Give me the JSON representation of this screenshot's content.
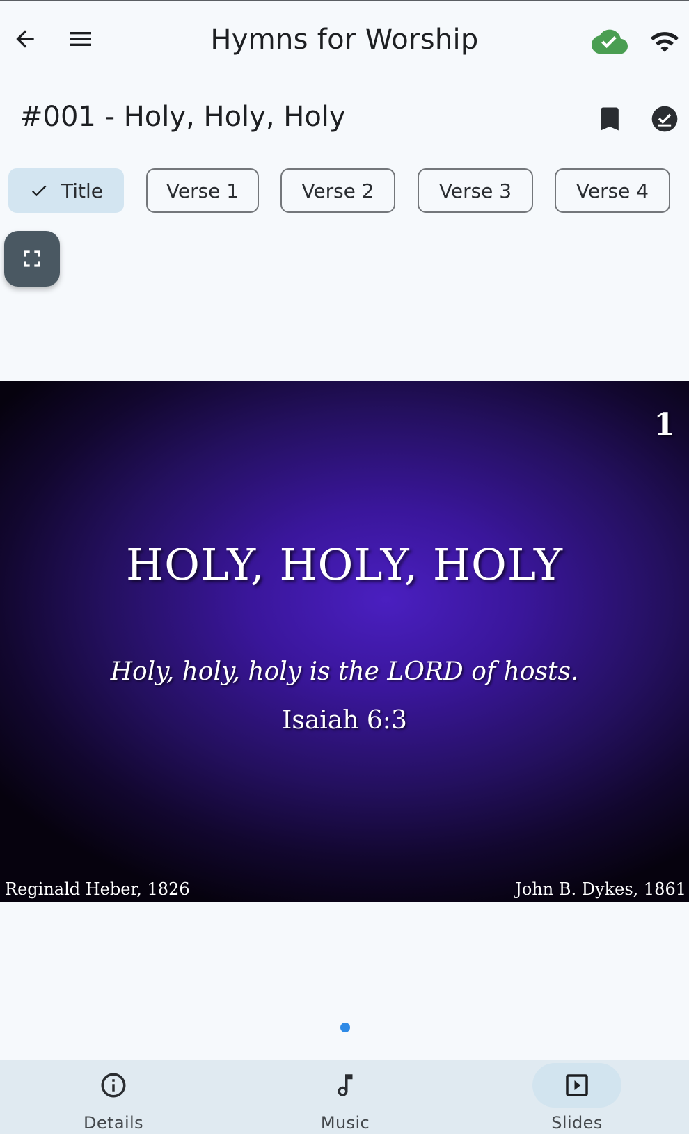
{
  "app_bar": {
    "title": "Hymns for Worship",
    "back_icon": "arrow-back-icon",
    "menu_icon": "menu-icon",
    "cloud_icon": "cloud-done-icon",
    "wifi_icon": "wifi-icon",
    "cloud_color": "#4a9e52"
  },
  "hymn": {
    "title": "#001 - Holy, Holy, Holy",
    "bookmark_icon": "bookmark-icon",
    "check_icon": "check-circle-icon"
  },
  "chips": [
    {
      "label": "Title",
      "selected": true
    },
    {
      "label": "Verse 1",
      "selected": false
    },
    {
      "label": "Verse 2",
      "selected": false
    },
    {
      "label": "Verse 3",
      "selected": false
    },
    {
      "label": "Verse 4",
      "selected": false
    }
  ],
  "fullscreen_icon": "fullscreen-icon",
  "slide": {
    "number": "1",
    "heading": "HOLY, HOLY, HOLY",
    "quote": "Holy, holy, holy is the LORD of hosts.",
    "reference": "Isaiah 6:3",
    "author": "Reginald Heber, 1826",
    "composer": "John B. Dykes, 1861"
  },
  "page_indicator": {
    "current": 1,
    "total": 1,
    "color": "#2e8ae6"
  },
  "bottom_nav": {
    "items": [
      {
        "label": "Details",
        "icon": "info-icon",
        "active": false
      },
      {
        "label": "Music",
        "icon": "music-note-icon",
        "active": false
      },
      {
        "label": "Slides",
        "icon": "slideshow-icon",
        "active": true
      }
    ]
  }
}
